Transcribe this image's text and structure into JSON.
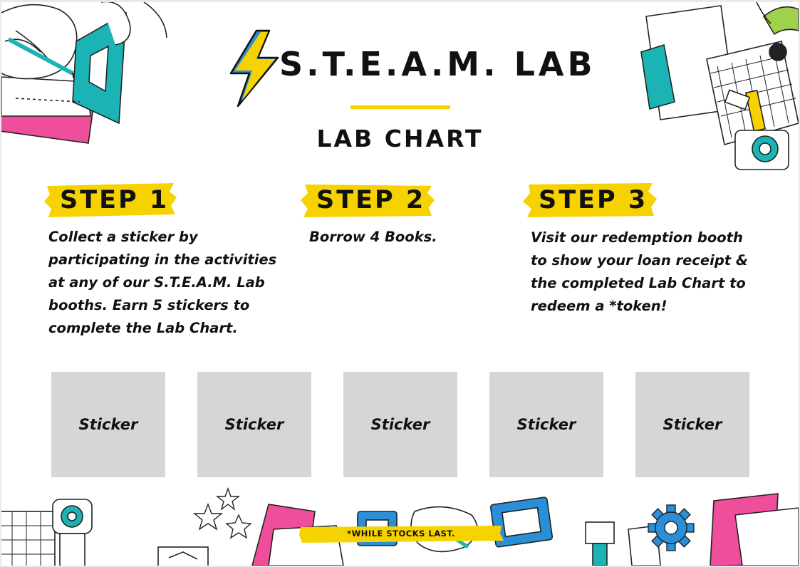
{
  "header": {
    "logo_text": "S.T.E.A.M. LAB",
    "subtitle": "LAB CHART"
  },
  "steps": [
    {
      "label": "STEP 1",
      "text": [
        "Collect a sticker by",
        "participating in the activities",
        "at any of our S.T.E.A.M. Lab",
        "booths. Earn 5 stickers to",
        "complete the Lab Chart."
      ]
    },
    {
      "label": "STEP 2",
      "text": [
        "Borrow 4 Books."
      ]
    },
    {
      "label": "STEP 3",
      "text": [
        "Visit our redemption booth",
        "to show your loan receipt &",
        "the completed Lab Chart to",
        "redeem a *token!"
      ]
    }
  ],
  "stickers": [
    "Sticker",
    "Sticker",
    "Sticker",
    "Sticker",
    "Sticker"
  ],
  "footnote": "*WHILE STOCKS LAST.",
  "colors": {
    "accent_yellow": "#f6d200",
    "teal": "#1bb3b3",
    "pink": "#ef4f9a",
    "blue": "#2a8fd8",
    "lime": "#9fd14a",
    "sticker_box": "#d6d6d6"
  },
  "icons": [
    "lightning-bolt-icon",
    "star-icon",
    "gear-icon"
  ]
}
